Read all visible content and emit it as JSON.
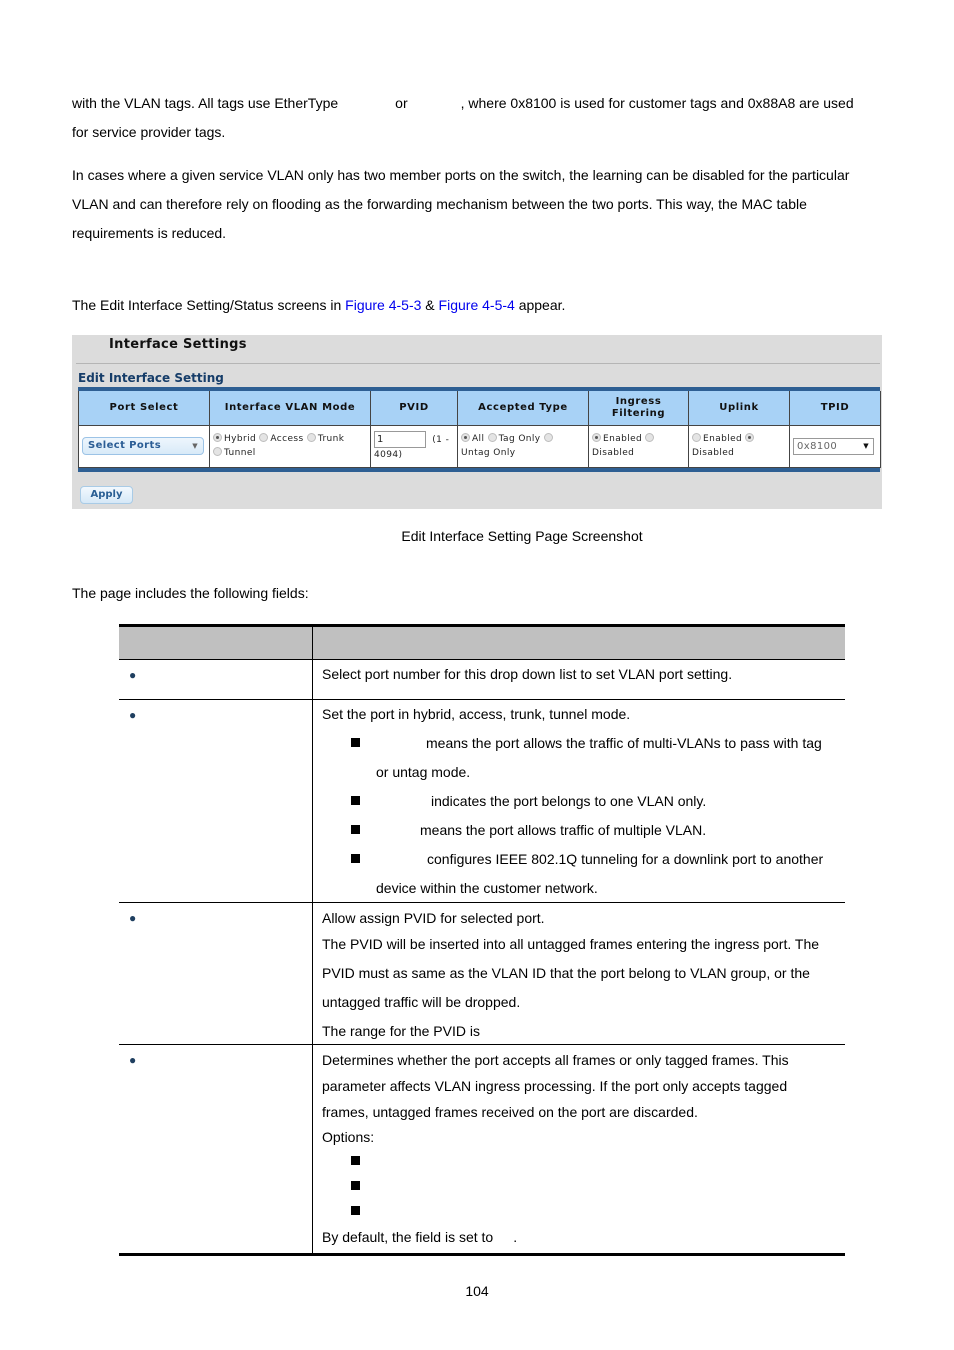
{
  "intro": {
    "p1_line1_a": "with the VLAN tags. All tags use EtherType",
    "p1_line1_b": "or",
    "p1_line1_c": ", where 0x8100 is used for customer tags and 0x88A8 are used",
    "p1_line2": "for service provider tags.",
    "p2_line1": "In cases where a given service VLAN only has two member ports on the switch, the learning can be disabled for the particular",
    "p2_line2": "VLAN and can therefore rely on flooding as the forwarding mechanism between the two ports. This way, the MAC table",
    "p2_line3": "requirements is reduced.",
    "p3_a": "The Edit Interface Setting/Status screens in ",
    "p3_link1": "Figure 4-5-3",
    "p3_b": " & ",
    "p3_link2": "Figure 4-5-4",
    "p3_c": " appear."
  },
  "ui": {
    "title": "Interface Settings",
    "subtitle": "Edit Interface Setting",
    "columns": [
      "Port Select",
      "Interface VLAN Mode",
      "PVID",
      "Accepted Type",
      "Ingress",
      "Filtering",
      "Uplink",
      "TPID"
    ],
    "port_select": "Select Ports",
    "modes": [
      "Hybrid",
      "Access",
      "Trunk",
      "Tunnel"
    ],
    "mode_selected": "Hybrid",
    "pvid_value": "1",
    "pvid_range_a": "(1 -",
    "pvid_range_b": "4094)",
    "accepted_types": [
      "All",
      "Tag Only",
      "Untag Only"
    ],
    "accepted_selected": "All",
    "ingress_options": [
      "Enabled",
      "Disabled"
    ],
    "ingress_selected": "Enabled",
    "uplink_options": [
      "Enabled",
      "Disabled"
    ],
    "uplink_selected": "Disabled",
    "tpid_value": "0x8100",
    "apply_label": "Apply"
  },
  "caption": "Edit Interface Setting Page Screenshot",
  "fields_intro": "The page includes the following fields:",
  "fields": {
    "port_select_desc": "Select port number for this drop down list to set VLAN port setting.",
    "mode_desc": "Set the port in hybrid, access, trunk, tunnel mode.",
    "mode_hybrid_a": "means the port allows the traffic of multi-VLANs to pass with tag",
    "mode_hybrid_b": "or untag mode.",
    "mode_access": "indicates the port belongs to one VLAN only.",
    "mode_trunk": "means the port allows traffic of multiple VLAN.",
    "mode_tunnel_a": "configures IEEE 802.1Q tunneling for a downlink port to another",
    "mode_tunnel_b": "device within the customer network.",
    "pvid_1": "Allow assign PVID for selected port.",
    "pvid_2": "The PVID will be inserted into all untagged frames entering the ingress port. The",
    "pvid_3": "PVID must as same as the VLAN ID that the port belong to VLAN group, or the",
    "pvid_4": "untagged traffic will be dropped.",
    "pvid_5": "The range for the PVID is",
    "acc_1": "Determines whether the port accepts all frames or only tagged frames. This",
    "acc_2": "parameter affects VLAN ingress processing. If the port only accepts tagged",
    "acc_3": "frames, untagged frames received on the port are discarded.",
    "acc_4": "Options:",
    "acc_default": "By default, the field is set to",
    "acc_default_end": "."
  },
  "page_number": "104"
}
